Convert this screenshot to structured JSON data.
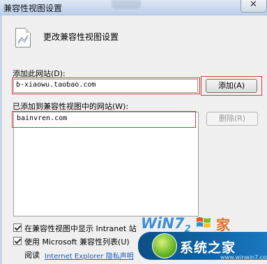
{
  "window": {
    "title": "兼容性视图设置",
    "close_glyph": "✕",
    "header_text": "更改兼容性视图设置"
  },
  "add_section": {
    "label": "添加此网站(D):",
    "input_value": "b-xiaowu.taobao.com",
    "add_button": "添加(A)"
  },
  "list_section": {
    "label": "已添加到兼容性视图中的网站(W):",
    "items": [
      "bainvren.com"
    ],
    "remove_button": "删除(R)"
  },
  "options": {
    "show_intranet": {
      "label": "在兼容性视图中显示 Intranet 站",
      "checked": true
    },
    "use_ms_list": {
      "label": "使用 Microsoft 兼容性列表(U)",
      "checked": true
    },
    "read_prefix": "阅读",
    "privacy_link": "Internet Explorer 隐私声明"
  },
  "watermark": {
    "logo_text": "WiN7",
    "logo_sub": "2",
    "home_glyph": "家",
    "name": "系统之家",
    "url": "www.winwin7.com"
  },
  "icons": [
    "document-icon",
    "close-icon",
    "checkbox-icon",
    "windows-flag-icon"
  ],
  "colors": {
    "titlebar": "#c9d9ee",
    "highlight_border": "#d23c3c",
    "link": "#1a5fb4"
  }
}
